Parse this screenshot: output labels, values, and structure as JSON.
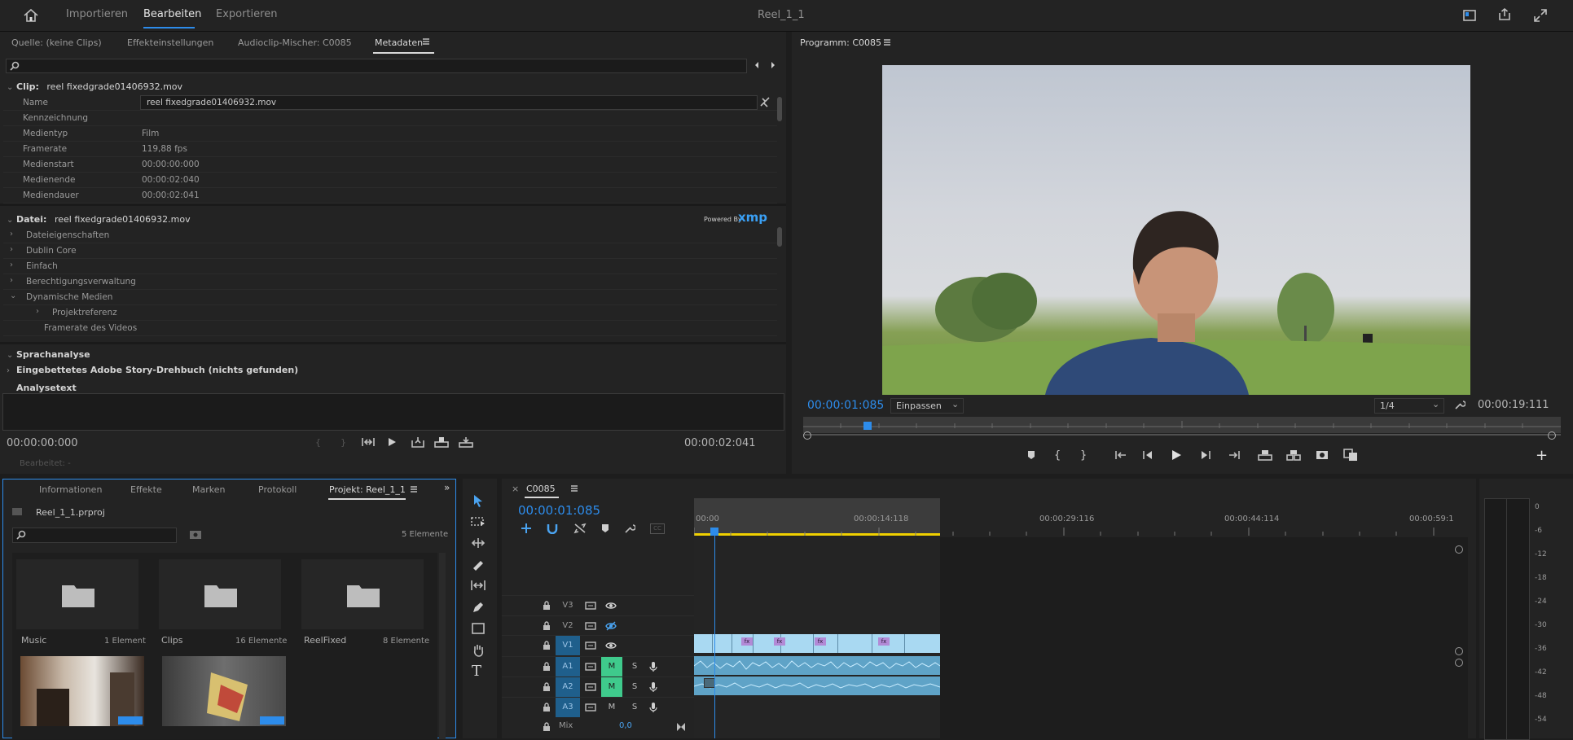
{
  "window": {
    "title": "Reel_1_1"
  },
  "workspaces": {
    "items": [
      "Importieren",
      "Bearbeiten",
      "Exportieren"
    ],
    "active": "Bearbeiten"
  },
  "source_panel": {
    "tabs": [
      "Quelle: (keine Clips)",
      "Effekteinstellungen",
      "Audioclip-Mischer: C0085",
      "Metadaten"
    ],
    "active_tab": "Metadaten",
    "clip_header_label": "Clip:",
    "clip_header_value": "reel fixedgrade01406932.mov",
    "clip_rows": [
      {
        "label": "Name",
        "value": "reel fixedgrade01406932.mov"
      },
      {
        "label": "Kennzeichnung",
        "value": ""
      },
      {
        "label": "Medientyp",
        "value": "Film"
      },
      {
        "label": "Framerate",
        "value": "119,88 fps"
      },
      {
        "label": "Medienstart",
        "value": "00:00:00:000"
      },
      {
        "label": "Medienende",
        "value": "00:00:02:040"
      },
      {
        "label": "Mediendauer",
        "value": "00:00:02:041"
      }
    ],
    "file_header_label": "Datei:",
    "file_header_value": "reel fixedgrade01406932.mov",
    "powered_by": "Powered By",
    "xmp": "xmp",
    "file_rows": [
      "Dateieigenschaften",
      "Dublin Core",
      "Einfach",
      "Berechtigungsverwaltung",
      "Dynamische Medien",
      "Projektreferenz",
      "Framerate des Videos"
    ],
    "speech_header": "Sprachanalyse",
    "speech_script": "Eingebettetes Adobe Story-Drehbuch (nichts gefunden)",
    "analysis_text_label": "Analysetext",
    "tc_left": "00:00:00:000",
    "tc_right": "00:00:02:041",
    "bearbeitet_label": "Bearbeitet:",
    "bearbeitet_value": "-"
  },
  "program_monitor": {
    "title": "Programm: C0085",
    "current_tc": "00:00:01:085",
    "fit": "Einpassen",
    "resolution": "1/4",
    "duration": "00:00:19:111"
  },
  "project_panel": {
    "tabs": [
      "Informationen",
      "Effekte",
      "Marken",
      "Protokoll",
      "Projekt: Reel_1_1"
    ],
    "active_tab": "Projekt: Reel_1_1",
    "project_file": "Reel_1_1.prproj",
    "element_count": "5 Elemente",
    "bins": [
      {
        "name": "Music",
        "count": "1 Element"
      },
      {
        "name": "Clips",
        "count": "16 Elemente"
      },
      {
        "name": "ReelFixed",
        "count": "8 Elemente"
      }
    ]
  },
  "timeline": {
    "sequence": "C0085",
    "current_tc": "00:00:01:085",
    "ruler_labels": [
      "00:00",
      "00:00:14:118",
      "00:00:29:116",
      "00:00:44:114",
      "00:00:59:1"
    ],
    "video_tracks": [
      "V3",
      "V2",
      "V1"
    ],
    "audio_tracks": [
      "A1",
      "A2",
      "A3"
    ],
    "m": "M",
    "s": "S",
    "mix_label": "Mix",
    "mix_value": "0,0",
    "fx": "fx"
  },
  "meter": {
    "scale": [
      "0",
      "-6",
      "-12",
      "-18",
      "-24",
      "-30",
      "-36",
      "-42",
      "-48",
      "-54"
    ]
  },
  "colors": {
    "accent": "#2d8ceb",
    "clip_video": "#a9d9f2",
    "clip_audio": "#5fa3c7",
    "mute_green": "#3fca8c",
    "work_area": "#f0d000"
  }
}
